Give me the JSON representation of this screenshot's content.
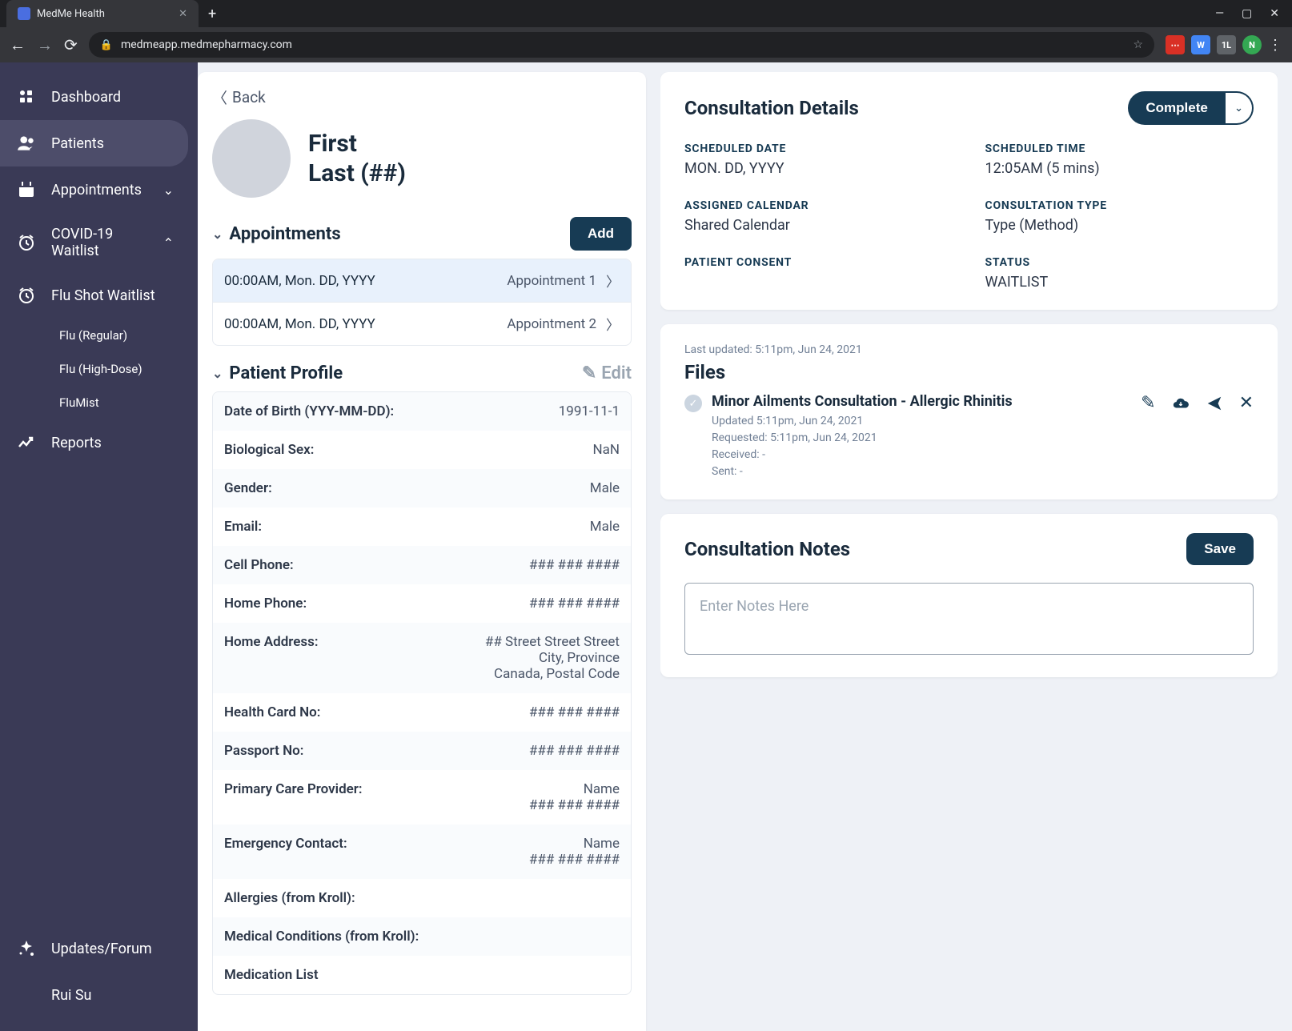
{
  "browser": {
    "tab_title": "MedMe Health",
    "url": "medmeapp.medmepharmacy.com"
  },
  "sidebar": {
    "items": [
      {
        "icon": "dashboard",
        "label": "Dashboard"
      },
      {
        "icon": "patients",
        "label": "Patients",
        "active": true
      },
      {
        "icon": "calendar",
        "label": "Appointments",
        "chev": "down"
      },
      {
        "icon": "clock",
        "label": "COVID-19 Waitlist",
        "chev": "up"
      },
      {
        "icon": "clock",
        "label": "Flu Shot Waitlist"
      }
    ],
    "subitems": [
      "Flu (Regular)",
      "Flu (High-Dose)",
      "FluMist"
    ],
    "reports": {
      "label": "Reports"
    },
    "updates": {
      "label": "Updates/Forum"
    },
    "user": {
      "label": "Rui Su"
    }
  },
  "back": "Back",
  "patient": {
    "first": "First",
    "last": "Last (##)"
  },
  "sections": {
    "appointments": "Appointments",
    "profile": "Patient Profile"
  },
  "buttons": {
    "add": "Add",
    "edit": "Edit",
    "complete": "Complete",
    "save": "Save"
  },
  "appointments": [
    {
      "time": "00:00AM, Mon. DD, YYYY",
      "label": "Appointment 1",
      "selected": true
    },
    {
      "time": "00:00AM, Mon. DD, YYYY",
      "label": "Appointment 2",
      "selected": false
    }
  ],
  "profile": [
    {
      "label": "Date of Birth (YYY-MM-DD):",
      "value": "1991-11-1"
    },
    {
      "label": "Biological Sex:",
      "value": "NaN"
    },
    {
      "label": "Gender:",
      "value": "Male"
    },
    {
      "label": "Email:",
      "value": "Male"
    },
    {
      "label": "Cell Phone:",
      "value": "### ### ####"
    },
    {
      "label": "Home Phone:",
      "value": "### ### ####"
    },
    {
      "label": "Home Address:",
      "value": "## Street Street Street\nCity, Province\nCanada, Postal Code"
    },
    {
      "label": "Health Card No:",
      "value": "### ### ####"
    },
    {
      "label": "Passport No:",
      "value": "### ### ####"
    },
    {
      "label": "Primary Care Provider:",
      "value": "Name\n### ### ####"
    },
    {
      "label": "Emergency Contact:",
      "value": "Name\n### ### ####"
    },
    {
      "label": "Allergies (from Kroll):",
      "value": ""
    },
    {
      "label": "Medical Conditions (from Kroll):",
      "value": ""
    },
    {
      "label": "Medication List",
      "value": ""
    }
  ],
  "consultation": {
    "title": "Consultation Details",
    "fields": {
      "scheduled_date": {
        "label": "SCHEDULED DATE",
        "value": "MON. DD, YYYY"
      },
      "scheduled_time": {
        "label": "SCHEDULED TIME",
        "value": "12:05AM (5 mins)"
      },
      "assigned_calendar": {
        "label": "ASSIGNED CALENDAR",
        "value": "Shared Calendar"
      },
      "consultation_type": {
        "label": "CONSULTATION TYPE",
        "value": "Type (Method)"
      },
      "patient_consent": {
        "label": "PATIENT CONSENT",
        "value": ""
      },
      "status": {
        "label": "STATUS",
        "value": "WAITLIST"
      }
    }
  },
  "files": {
    "last_updated": "Last updated: 5:11pm, Jun 24, 2021",
    "title": "Files",
    "items": [
      {
        "title": "Minor Ailments Consultation - Allergic Rhinitis",
        "updated": "Updated 5:11pm, Jun 24, 2021",
        "requested": "Requested: 5:11pm, Jun 24, 2021",
        "received": "Received: -",
        "sent": "Sent: -"
      }
    ]
  },
  "notes": {
    "title": "Consultation Notes",
    "placeholder": "Enter Notes Here"
  }
}
